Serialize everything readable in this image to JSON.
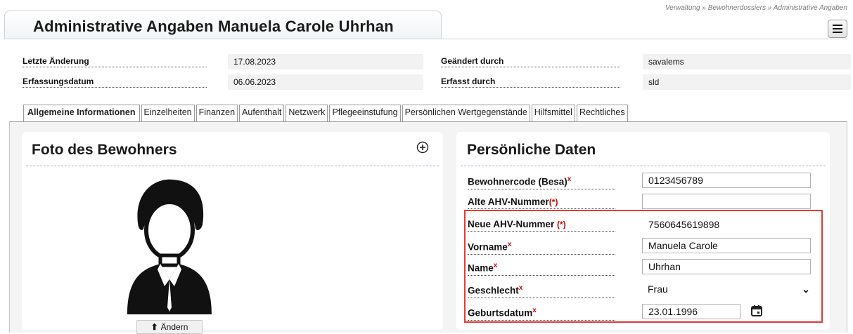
{
  "breadcrumb": "Verwaltung » Bewohnerdossiers » Administrative Angaben",
  "page_title": "Administrative Angaben Manuela Carole Uhrhan",
  "meta": {
    "last_change_label": "Letzte Änderung",
    "last_change_value": "17.08.2023",
    "changed_by_label": "Geändert durch",
    "changed_by_value": "savalems",
    "created_date_label": "Erfassungsdatum",
    "created_date_value": "06.06.2023",
    "created_by_label": "Erfasst durch",
    "created_by_value": "sld"
  },
  "tabs": [
    "Allgemeine Informationen",
    "Einzelheiten",
    "Finanzen",
    "Aufenthalt",
    "Netzwerk",
    "Pflegeeinstufung",
    "Persönlichen Wertgegenstände",
    "Hilfsmittel",
    "Rechtliches"
  ],
  "photo_panel": {
    "title": "Foto des Bewohners",
    "change_label": "Ändern"
  },
  "personal_panel": {
    "title": "Persönliche Daten",
    "fields": {
      "besa_code_label": "Bewohnercode (Besa)",
      "besa_code_value": "0123456789",
      "old_ahv_label": "Alte AHV-Nummer",
      "old_ahv_value": "",
      "new_ahv_label": "Neue AHV-Nummer",
      "new_ahv_value": "7560645619898",
      "firstname_label": "Vorname",
      "firstname_value": "Manuela Carole",
      "name_label": "Name",
      "name_value": "Uhrhan",
      "gender_label": "Geschlecht",
      "gender_value": "Frau",
      "birthdate_label": "Geburtsdatum",
      "birthdate_value": "23.01.1996"
    },
    "required_mark": "x",
    "optional_required_mark": "(*)"
  },
  "colors": {
    "highlight": "#e53935",
    "required": "#d00000"
  }
}
